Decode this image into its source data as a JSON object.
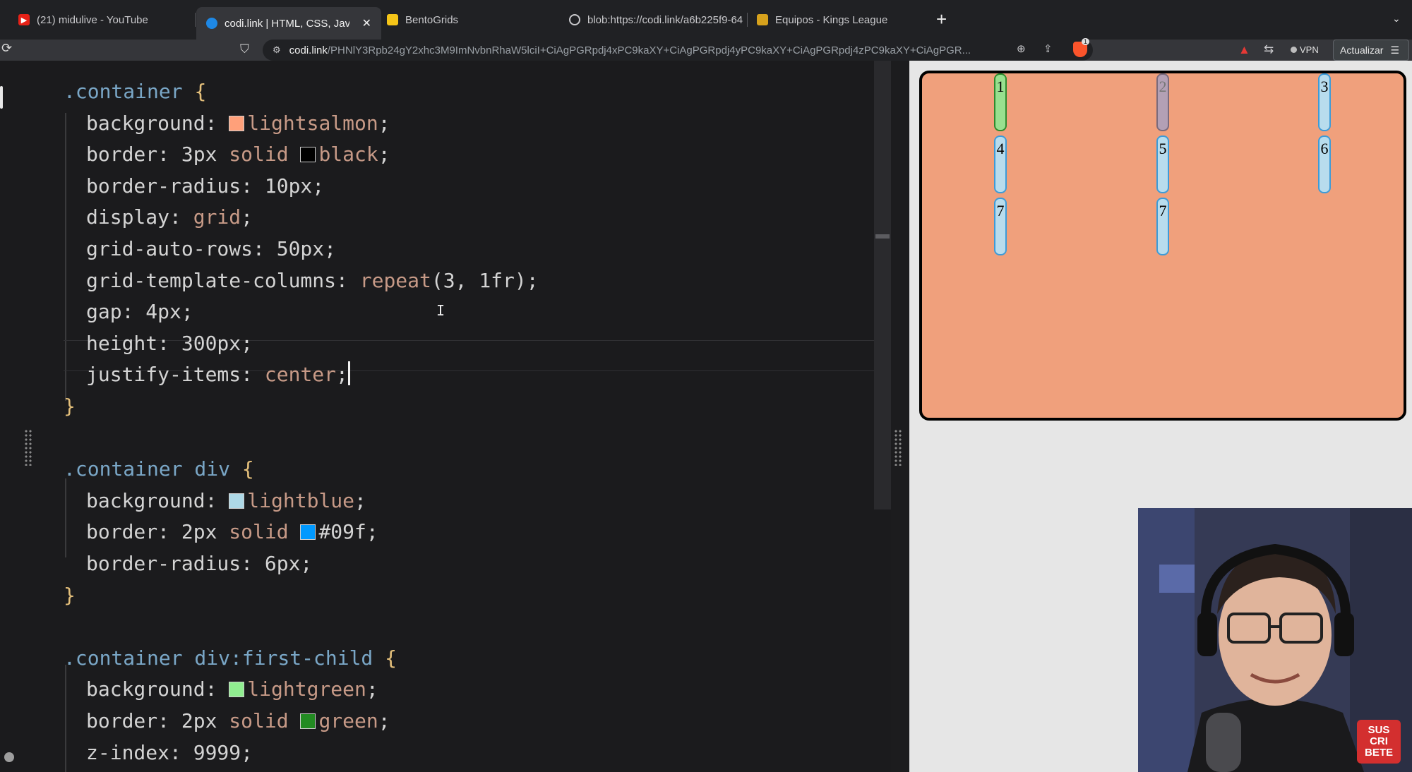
{
  "browser": {
    "tabs": [
      {
        "title": "(21) midulive - YouTube",
        "icon": "youtube-icon"
      },
      {
        "title": "codi.link | HTML, CSS, JavaScr",
        "icon": "codi-icon",
        "active": true
      },
      {
        "title": "BentoGrids",
        "icon": "bento-icon"
      },
      {
        "title": "blob:https://codi.link/a6b225f9-64",
        "icon": "globe-icon"
      },
      {
        "title": "Equipos - Kings League",
        "icon": "kings-league-icon"
      }
    ],
    "close_symbol": "✕",
    "new_tab_symbol": "+",
    "address": {
      "host": "codi.link",
      "path": "/PHNlY3Rpb24gY2xhc3M9ImNvbnRhaW5lciI+CiAgPGRpdj4xPC9kaXY+CiAgPGRpdj4yPC9kaXY+CiAgPGRpdj4zPC9kaXY+CiAgPGR..."
    },
    "vpn_label": "VPN",
    "update_label": "Actualizar",
    "badge_count": "1"
  },
  "code": {
    "lines": [
      {
        "indent": 0,
        "parts": [
          {
            "t": ".container ",
            "c": "sel"
          },
          {
            "t": "{",
            "c": "brace"
          }
        ]
      },
      {
        "indent": 1,
        "parts": [
          {
            "t": "background: ",
            "c": "prop"
          },
          {
            "sw": "#ffa07a"
          },
          {
            "t": "lightsalmon",
            "c": "kw"
          },
          {
            "t": ";",
            "c": "prop"
          }
        ]
      },
      {
        "indent": 1,
        "parts": [
          {
            "t": "border: 3px ",
            "c": "prop"
          },
          {
            "t": "solid ",
            "c": "kw"
          },
          {
            "sw": "#000000"
          },
          {
            "t": "black",
            "c": "kw"
          },
          {
            "t": ";",
            "c": "prop"
          }
        ]
      },
      {
        "indent": 1,
        "parts": [
          {
            "t": "border-radius: 10px;",
            "c": "prop"
          }
        ]
      },
      {
        "indent": 1,
        "parts": [
          {
            "t": "display: ",
            "c": "prop"
          },
          {
            "t": "grid",
            "c": "kw"
          },
          {
            "t": ";",
            "c": "prop"
          }
        ]
      },
      {
        "indent": 1,
        "parts": [
          {
            "t": "grid-auto-rows: 50px;",
            "c": "prop"
          }
        ]
      },
      {
        "indent": 1,
        "parts": [
          {
            "t": "grid-template-columns: ",
            "c": "prop"
          },
          {
            "t": "repeat",
            "c": "kw"
          },
          {
            "t": "(3, 1fr);",
            "c": "prop"
          }
        ]
      },
      {
        "indent": 1,
        "parts": [
          {
            "t": "gap: 4px;",
            "c": "prop"
          }
        ]
      },
      {
        "indent": 1,
        "parts": [
          {
            "t": "height: 300px;",
            "c": "prop"
          }
        ]
      },
      {
        "indent": 1,
        "parts": [
          {
            "t": "justify-items: ",
            "c": "prop"
          },
          {
            "t": "center",
            "c": "kw"
          },
          {
            "t": ";",
            "c": "prop"
          }
        ],
        "caret": true
      },
      {
        "indent": 0,
        "parts": [
          {
            "t": "}",
            "c": "brace"
          }
        ]
      },
      {
        "indent": 0,
        "parts": []
      },
      {
        "indent": 0,
        "parts": [
          {
            "t": ".container div ",
            "c": "sel"
          },
          {
            "t": "{",
            "c": "brace"
          }
        ]
      },
      {
        "indent": 1,
        "parts": [
          {
            "t": "background: ",
            "c": "prop"
          },
          {
            "sw": "#add8e6"
          },
          {
            "t": "lightblue",
            "c": "kw"
          },
          {
            "t": ";",
            "c": "prop"
          }
        ]
      },
      {
        "indent": 1,
        "parts": [
          {
            "t": "border: 2px ",
            "c": "prop"
          },
          {
            "t": "solid ",
            "c": "kw"
          },
          {
            "sw": "#0099ff"
          },
          {
            "t": "#09f;",
            "c": "prop"
          }
        ]
      },
      {
        "indent": 1,
        "parts": [
          {
            "t": "border-radius: 6px;",
            "c": "prop"
          }
        ]
      },
      {
        "indent": 0,
        "parts": [
          {
            "t": "}",
            "c": "brace"
          }
        ]
      },
      {
        "indent": 0,
        "parts": []
      },
      {
        "indent": 0,
        "parts": [
          {
            "t": ".container div:first-child ",
            "c": "sel"
          },
          {
            "t": "{",
            "c": "brace"
          }
        ]
      },
      {
        "indent": 1,
        "parts": [
          {
            "t": "background: ",
            "c": "prop"
          },
          {
            "sw": "#90ee90"
          },
          {
            "t": "lightgreen",
            "c": "kw"
          },
          {
            "t": ";",
            "c": "prop"
          }
        ]
      },
      {
        "indent": 1,
        "parts": [
          {
            "t": "border: 2px ",
            "c": "prop"
          },
          {
            "t": "solid ",
            "c": "kw"
          },
          {
            "sw": "#228b22"
          },
          {
            "t": "green",
            "c": "kw"
          },
          {
            "t": ";",
            "c": "prop"
          }
        ]
      },
      {
        "indent": 1,
        "parts": [
          {
            "t": "z-index: 9999;",
            "c": "prop"
          }
        ]
      }
    ]
  },
  "preview": {
    "cells": [
      "1",
      "2",
      "3",
      "4",
      "5",
      "6",
      "7",
      "7"
    ]
  },
  "overlay": {
    "subscribe_lines": [
      "SUS",
      "CRI",
      "BETE"
    ]
  },
  "colors": {
    "container_bg": "#f0a07c",
    "cell_bg": "#b8dced",
    "cell_border": "#3d9bd8",
    "first_cell_bg": "#98e08f"
  }
}
